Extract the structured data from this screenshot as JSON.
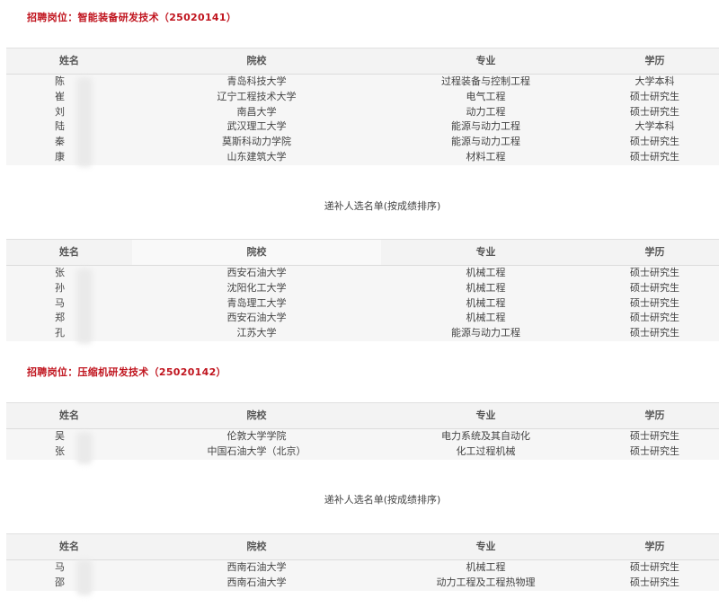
{
  "sections": [
    {
      "title": "招聘岗位：智能装备研发技术（25020141）",
      "headers": [
        "姓名",
        "院校",
        "专业",
        "学历"
      ],
      "rows": [
        {
          "name": "陈",
          "school": "青岛科技大学",
          "major": "过程装备与控制工程",
          "degree": "大学本科"
        },
        {
          "name": "崔",
          "school": "辽宁工程技术大学",
          "major": "电气工程",
          "degree": "硕士研究生"
        },
        {
          "name": "刘",
          "school": "南昌大学",
          "major": "动力工程",
          "degree": "硕士研究生"
        },
        {
          "name": "陆",
          "school": "武汉理工大学",
          "major": "能源与动力工程",
          "degree": "大学本科"
        },
        {
          "name": "秦",
          "school": "莫斯科动力学院",
          "major": "能源与动力工程",
          "degree": "硕士研究生"
        },
        {
          "name": "康",
          "school": "山东建筑大学",
          "major": "材料工程",
          "degree": "硕士研究生"
        }
      ],
      "backup_title": "递补人选名单(按成绩排序)",
      "backup_rows": [
        {
          "name": "张",
          "school": "西安石油大学",
          "major": "机械工程",
          "degree": "硕士研究生"
        },
        {
          "name": "孙",
          "school": "沈阳化工大学",
          "major": "机械工程",
          "degree": "硕士研究生"
        },
        {
          "name": "马",
          "school": "青岛理工大学",
          "major": "机械工程",
          "degree": "硕士研究生"
        },
        {
          "name": "郑",
          "school": "西安石油大学",
          "major": "机械工程",
          "degree": "硕士研究生"
        },
        {
          "name": "孔",
          "school": "江苏大学",
          "major": "能源与动力工程",
          "degree": "硕士研究生"
        }
      ]
    },
    {
      "title": "招聘岗位：压缩机研发技术（25020142）",
      "headers": [
        "姓名",
        "院校",
        "专业",
        "学历"
      ],
      "rows": [
        {
          "name": "吴",
          "school": "伦敦大学学院",
          "major": "电力系统及其自动化",
          "degree": "硕士研究生"
        },
        {
          "name": "张",
          "school": "中国石油大学（北京）",
          "major": "化工过程机械",
          "degree": "硕士研究生"
        }
      ],
      "backup_title": "递补人选名单(按成绩排序)",
      "backup_rows": [
        {
          "name": "马",
          "school": "西南石油大学",
          "major": "机械工程",
          "degree": "硕士研究生"
        },
        {
          "name": "邵",
          "school": "西南石油大学",
          "major": "动力工程及工程热物理",
          "degree": "硕士研究生"
        }
      ]
    }
  ]
}
